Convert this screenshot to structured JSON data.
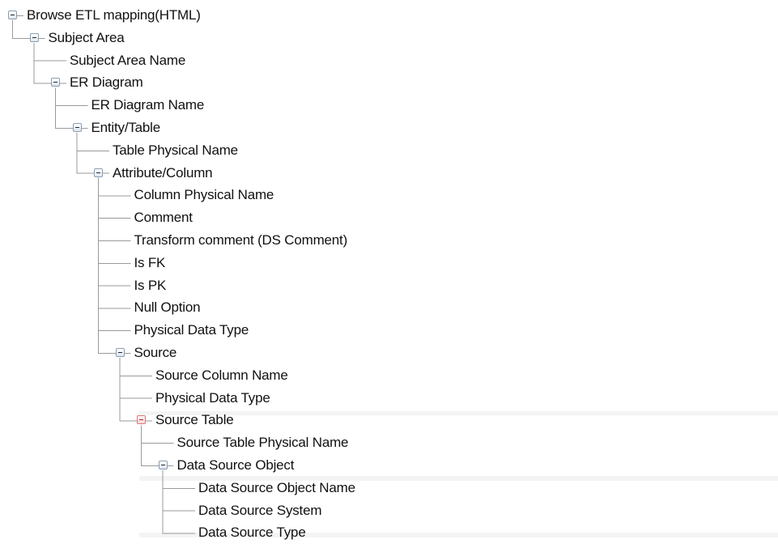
{
  "tree": {
    "nodes": [
      {
        "label": "Browse ETL mapping(HTML)",
        "depth": 0,
        "expandable": true
      },
      {
        "label": "Subject Area",
        "depth": 1,
        "expandable": true
      },
      {
        "label": "Subject Area Name",
        "depth": 2,
        "expandable": false
      },
      {
        "label": "ER Diagram",
        "depth": 2,
        "expandable": true
      },
      {
        "label": "ER Diagram Name",
        "depth": 3,
        "expandable": false
      },
      {
        "label": "Entity/Table",
        "depth": 3,
        "expandable": true
      },
      {
        "label": "Table Physical Name",
        "depth": 4,
        "expandable": false
      },
      {
        "label": "Attribute/Column",
        "depth": 4,
        "expandable": true
      },
      {
        "label": "Column Physical Name",
        "depth": 5,
        "expandable": false
      },
      {
        "label": "Comment",
        "depth": 5,
        "expandable": false
      },
      {
        "label": "Transform comment (DS Comment)",
        "depth": 5,
        "expandable": false
      },
      {
        "label": "Is FK",
        "depth": 5,
        "expandable": false
      },
      {
        "label": "Is PK",
        "depth": 5,
        "expandable": false
      },
      {
        "label": "Null Option",
        "depth": 5,
        "expandable": false
      },
      {
        "label": "Physical Data Type",
        "depth": 5,
        "expandable": false
      },
      {
        "label": "Source",
        "depth": 5,
        "expandable": true
      },
      {
        "label": "Source Column Name",
        "depth": 6,
        "expandable": false
      },
      {
        "label": "Physical Data Type",
        "depth": 6,
        "expandable": false
      },
      {
        "label": "Source Table",
        "depth": 6,
        "expandable": true,
        "highlight": true
      },
      {
        "label": "Source Table Physical Name",
        "depth": 7,
        "expandable": false
      },
      {
        "label": "Data Source Object",
        "depth": 7,
        "expandable": true
      },
      {
        "label": "Data Source Object Name",
        "depth": 8,
        "expandable": false
      },
      {
        "label": "Data Source System",
        "depth": 8,
        "expandable": false
      },
      {
        "label": "Data Source Type",
        "depth": 8,
        "expandable": false
      }
    ]
  },
  "colors": {
    "text": "#111111",
    "connector": "#9a9a9a",
    "expander_border": "#8a9db3",
    "highlight_expander_border": "#d87a7a"
  }
}
